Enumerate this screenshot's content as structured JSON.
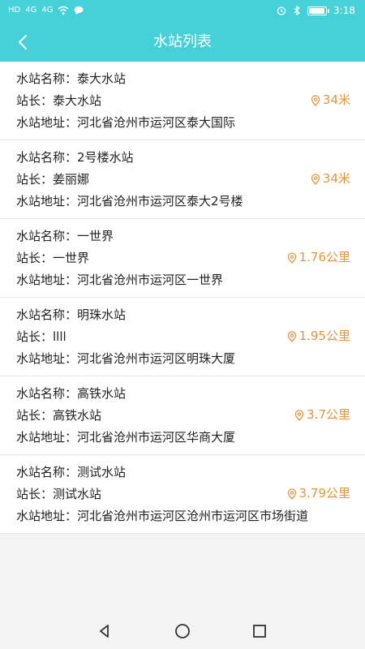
{
  "status_bar": {
    "left_icons": [
      "HD",
      "4G",
      "4G",
      "wifi-icon",
      "message-icon"
    ],
    "right_icons": [
      "alarm-icon",
      "bluetooth-icon",
      "battery-icon"
    ],
    "battery_percent": 95,
    "time": "3:18",
    "color": "#46d1d8"
  },
  "header": {
    "title": "水站列表",
    "back_icon": "chevron-left-icon"
  },
  "list": {
    "labels": {
      "name": "水站名称：",
      "manager": "站长：",
      "address": "水站地址："
    },
    "items": [
      {
        "name": "泰大水站",
        "manager": "泰大水站",
        "address": "河北省沧州市运河区泰大国际",
        "distance": "34米"
      },
      {
        "name": "2号楼水站",
        "manager": "姜丽娜",
        "address": "河北省沧州市运河区泰大2号楼",
        "distance": "34米"
      },
      {
        "name": "一世界",
        "manager": "一世界",
        "address": "河北省沧州市运河区一世界",
        "distance": "1.76公里"
      },
      {
        "name": "明珠水站",
        "manager": "llll",
        "address": "河北省沧州市运河区明珠大厦",
        "distance": "1.95公里"
      },
      {
        "name": "高铁水站",
        "manager": "高铁水站",
        "address": "河北省沧州市运河区华商大厦",
        "distance": "3.7公里"
      },
      {
        "name": "测试水站",
        "manager": "测试水站",
        "address": "河北省沧州市运河区沧州市运河区市场街道",
        "distance": "3.79公里"
      }
    ]
  },
  "navigation": {
    "back_icon": "triangle-back-icon",
    "home_icon": "circle-home-icon",
    "recent_icon": "square-recent-icon"
  },
  "colors": {
    "accent": "#46d1d8",
    "distance": "#e6953b"
  }
}
